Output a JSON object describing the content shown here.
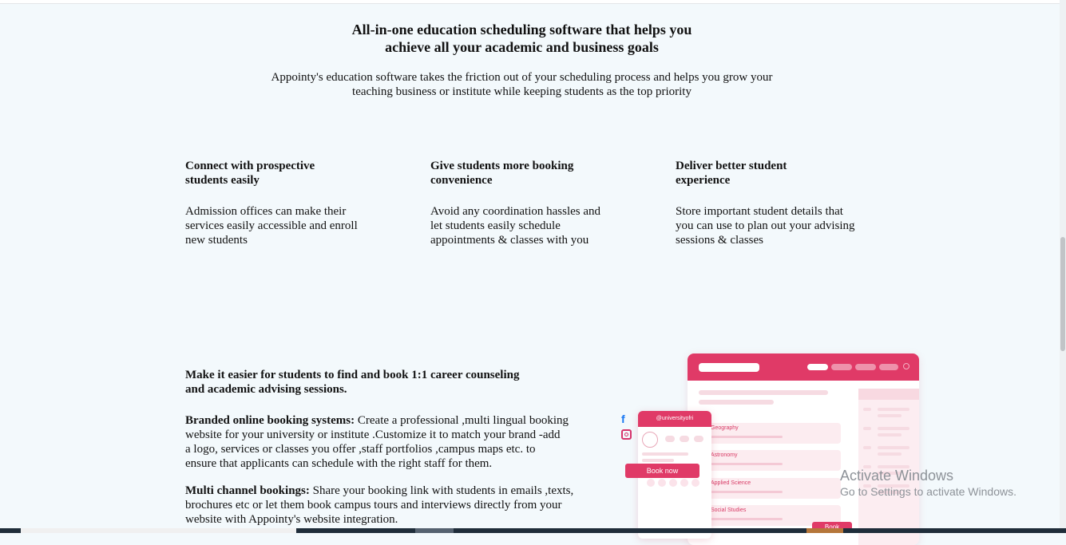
{
  "hero": {
    "title_line1": "All-in-one education scheduling software that helps you",
    "title_line2": "achieve all your academic and business goals",
    "subtitle_line1": "Appointy's education software takes the friction out of your scheduling process and helps you grow your",
    "subtitle_line2": "teaching business or institute while keeping students as the top priority"
  },
  "features": [
    {
      "title_line1": "Connect with prospective",
      "title_line2": "students easily",
      "desc_line1": "Admission offices can make their",
      "desc_line2": "services easily accessible and enroll",
      "desc_line3": "new students"
    },
    {
      "title_line1": "Give students more booking",
      "title_line2": "convenience",
      "desc_line1": "Avoid any coordination hassles and",
      "desc_line2": "let students easily schedule",
      "desc_line3": "appointments & classes with you"
    },
    {
      "title_line1": "Deliver better student",
      "title_line2": "experience",
      "desc_line1": "Store important student details that",
      "desc_line2": "you can use to plan out your advising",
      "desc_line3": "sessions & classes"
    }
  ],
  "section2": {
    "heading_line1": "Make it easier for students to find and book 1:1 career counseling",
    "heading_line2": "and academic advising sessions.",
    "p1_bold": "Branded online booking systems:",
    "p1_line1": " Create a professional ,multi lingual booking",
    "p1_line2": "website for your university or institute .Customize it to match your brand -add",
    "p1_line3": "a logo, services or classes you offer ,staff portfolios ,campus maps etc. to",
    "p1_line4": "ensure that applicants can schedule with the right staff for them.",
    "p2_bold": "Multi channel bookings:",
    "p2_line1": " Share your booking link with students in emails ,texts,",
    "p2_line2": "brochures etc or let them book campus tours and interviews directly from your",
    "p2_line3": "website with Appointy's website integration."
  },
  "illustration": {
    "handle": "@universityofri",
    "book_now": "Book now",
    "book_short": "Book",
    "subjects": [
      "Geography",
      "Astronomy",
      "Applied Science",
      "Social Studies"
    ],
    "icons": [
      "facebook-icon",
      "instagram-icon"
    ],
    "accent_color": "#e03a67"
  },
  "watermark": {
    "line1": "Activate Windows",
    "line2": "Go to Settings to activate Windows."
  }
}
